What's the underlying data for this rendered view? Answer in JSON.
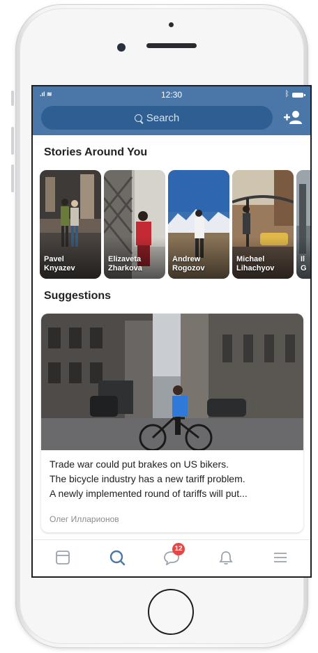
{
  "status": {
    "time": "12:30"
  },
  "header": {
    "search_placeholder": "Search"
  },
  "sections": {
    "stories_title": "Stories Around You",
    "suggestions_title": "Suggestions"
  },
  "stories": [
    {
      "first": "Pavel",
      "last": "Knyazev"
    },
    {
      "first": "Elizaveta",
      "last": "Zharkova"
    },
    {
      "first": "Andrew",
      "last": "Rogozov"
    },
    {
      "first": "Michael",
      "last": "Lihachyov"
    },
    {
      "first": "Il",
      "last": "G"
    }
  ],
  "suggestion": {
    "lines": [
      "Trade war could put brakes on US bikers.",
      "The bicycle industry has a new tariff problem.",
      "A newly implemented round of tariffs will put..."
    ],
    "author": "Олег Илларионов"
  },
  "tabbar": {
    "messages_badge": "12"
  },
  "colors": {
    "header": "#4a76a8",
    "accent": "#4a76a8",
    "badge": "#e64646"
  }
}
